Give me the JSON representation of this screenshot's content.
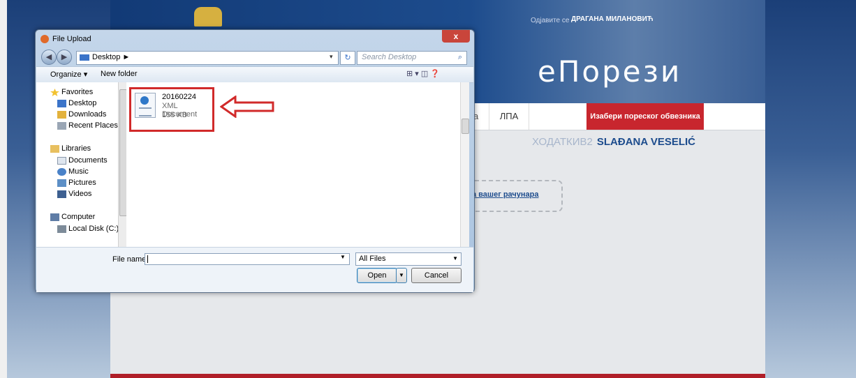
{
  "website": {
    "logout_label": "Одјавите се",
    "user_name": "ДРАГАНА МИЛАНОВИЋ",
    "logo_text": "еПорези",
    "nav": {
      "partial_item": "а",
      "lpa": "ЛПА",
      "choose_taxpayer": "Изабери пореског обвезника"
    },
    "taxpayer_name": "SLAĐANA VESELIĆ",
    "taxpayer_masked": "ХОДАТКИВ2",
    "upload_link": "а вашег рачунара",
    "colors": {
      "accent": "#c8262e",
      "banner": "#1d4c8d"
    }
  },
  "dialog": {
    "title": "File Upload",
    "close_label": "x",
    "back_icon": "back-arrow-icon",
    "address": {
      "location": "Desktop",
      "separator": "►",
      "dropdown": "▾"
    },
    "refresh_label": "↻",
    "search_placeholder": "Search Desktop",
    "toolbar": {
      "organize": "Organize ▾",
      "new_folder": "New folder",
      "view_icons": "⊞ ▾   ◫   ❓"
    },
    "nav_pane": {
      "favorites": "Favorites",
      "desktop": "Desktop",
      "downloads": "Downloads",
      "recent_places": "Recent Places",
      "libraries": "Libraries",
      "documents": "Documents",
      "music": "Music",
      "pictures": "Pictures",
      "videos": "Videos",
      "computer": "Computer",
      "local_disk": "Local Disk (C:)"
    },
    "file": {
      "name": "20160224",
      "type": "XML Document",
      "size": "155 KB"
    },
    "file_name_label": "File name:",
    "file_name_value": "",
    "filter_value": "All Files",
    "open_label": "Open",
    "cancel_label": "Cancel"
  }
}
